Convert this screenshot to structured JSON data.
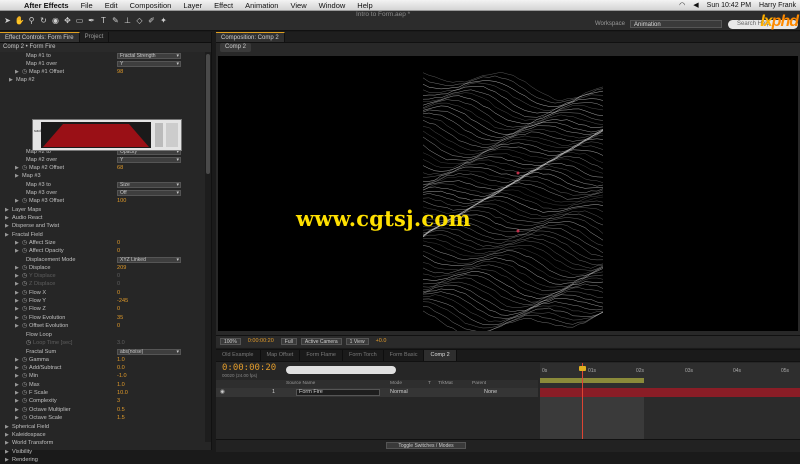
{
  "menubar": {
    "app_name": "After Effects",
    "items": [
      "File",
      "Edit",
      "Composition",
      "Layer",
      "Effect",
      "Animation",
      "View",
      "Window",
      "Help"
    ],
    "clock": "Sun 10:42 PM",
    "user": "Harry Frank"
  },
  "toolbar": {
    "document_title": "Intro to Form.aep *",
    "workspace_label": "Workspace",
    "workspace_value": "Animation",
    "search_placeholder": "Search Help"
  },
  "logo": {
    "part1": "lx",
    "part2": "phd"
  },
  "effect_controls": {
    "tabs": [
      "Effect Controls: Form Fire",
      "Project"
    ],
    "header": "Comp 2 • Form Fire",
    "rows": [
      {
        "label": "Map #1 to",
        "dropdown": "Fractal Strength"
      },
      {
        "label": "Map #1 over",
        "dropdown": "Y"
      },
      {
        "label": "Map #1 Offset",
        "value": "98"
      },
      {
        "label": "Map #2"
      },
      {
        "label": "Map #2 to",
        "dropdown": "Opacity"
      },
      {
        "label": "Map #2 over",
        "dropdown": "Y"
      },
      {
        "label": "Map #2 Offset",
        "value": "68"
      },
      {
        "label": "Map #3"
      },
      {
        "label": "Map #3 to",
        "dropdown": "Size"
      },
      {
        "label": "Map #3 over",
        "dropdown": "Off"
      },
      {
        "label": "Map #3 Offset",
        "value": "100"
      },
      {
        "label": "Layer Maps"
      },
      {
        "label": "Audio React"
      },
      {
        "label": "Disperse and Twist"
      },
      {
        "label": "Fractal Field"
      },
      {
        "label": "Affect Size",
        "value": "0"
      },
      {
        "label": "Affect Opacity",
        "value": "0"
      },
      {
        "label": "Displacement Mode",
        "dropdown": "XYZ Linked"
      },
      {
        "label": "Displace",
        "value": "209"
      },
      {
        "label": "Y Displace",
        "value": "0"
      },
      {
        "label": "Z Displace",
        "value": "0"
      },
      {
        "label": "Flow X",
        "value": "0"
      },
      {
        "label": "Flow Y",
        "value": "-245"
      },
      {
        "label": "Flow Z",
        "value": "0"
      },
      {
        "label": "Flow Evolution",
        "value": "35"
      },
      {
        "label": "Offset Evolution",
        "value": "0"
      },
      {
        "label": "Flow Loop"
      },
      {
        "label": "Loop Time [sec]",
        "value": "3.0"
      },
      {
        "label": "Fractal Sum",
        "dropdown": "abs(noise)"
      },
      {
        "label": "Gamma",
        "value": "1.0"
      },
      {
        "label": "Add/Subtract",
        "value": "0.0"
      },
      {
        "label": "Min",
        "value": "-1.0"
      },
      {
        "label": "Max",
        "value": "1.0"
      },
      {
        "label": "F Scale",
        "value": "10.0"
      },
      {
        "label": "Complexity",
        "value": "3"
      },
      {
        "label": "Octave Multiplier",
        "value": "0.5"
      },
      {
        "label": "Octave Scale",
        "value": "1.5"
      },
      {
        "label": "Spherical Field"
      },
      {
        "label": "Kaleidospace"
      },
      {
        "label": "World Transform"
      },
      {
        "label": "Visibility"
      },
      {
        "label": "Rendering"
      }
    ],
    "graph_label": "Map #2"
  },
  "composition": {
    "tab": "Composition: Comp 2",
    "subtab": "Comp 2",
    "watermark": "www.cgtsj.com",
    "viewbar": {
      "zoom": "100%",
      "timecode": "0:00:00:20",
      "resolution": "Full",
      "camera": "Active Camera",
      "views": "1 View",
      "exposure": "+0.0"
    }
  },
  "timeline": {
    "tabs": [
      "Old Example",
      "Map Offset",
      "Form Flame",
      "Form Torch",
      "Form Basic",
      "Comp 2"
    ],
    "timecode": "0:00:00:20",
    "fps": "00020 (24.00 fps)",
    "columns": {
      "source": "Source Name",
      "mode": "Mode",
      "t": "T",
      "trkmat": "TrkMat",
      "parent": "Parent"
    },
    "layer": {
      "index": "1",
      "name": "Form Fire",
      "mode": "Normal",
      "parent": "None"
    },
    "ruler": [
      "0s",
      "01s",
      "02s",
      "03s",
      "04s",
      "05s"
    ],
    "toggle_label": "Toggle Switches / Modes"
  },
  "colors": {
    "accent": "#e09a2a",
    "track": "#8a1d26",
    "watermark": "#ffe000"
  }
}
